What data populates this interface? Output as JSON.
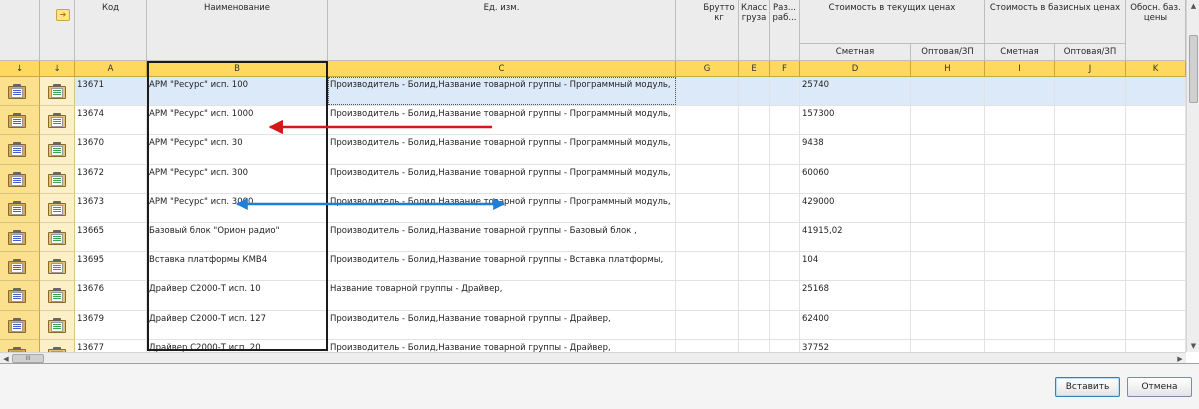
{
  "headers": {
    "col_a": "Код",
    "col_b": "Наименование",
    "col_c": "Ед. изм.",
    "col_g": "Брутто кг",
    "col_e": "Класс груза",
    "col_f": "Раз... раб...",
    "group_current": "Стоимость в текущих ценах",
    "group_base": "Стоимость в базисных ценах",
    "col_k": "Обосн. баз. цены",
    "sub_d": "Сметная",
    "sub_h": "Оптовая/ЗП",
    "sub_i": "Сметная",
    "sub_j": "Оптовая/ЗП"
  },
  "header_icon": "arrow-right-icon",
  "letters": {
    "down1": "↓",
    "down2": "↓",
    "a": "A",
    "b": "B",
    "c": "C",
    "g": "G",
    "e": "E",
    "f": "F",
    "d": "D",
    "h": "H",
    "i": "I",
    "j": "J",
    "k": "K"
  },
  "rows": [
    {
      "code": "13671",
      "name": "АРМ \"Ресурс\" исп. 100",
      "unit": "Производитель - Болид,Название товарной группы - Программный модуль,",
      "price": "25740",
      "selected": true
    },
    {
      "code": "13674",
      "name": "АРМ \"Ресурс\" исп. 1000",
      "unit": "Производитель - Болид,Название товарной группы - Программный модуль,",
      "price": "157300"
    },
    {
      "code": "13670",
      "name": "АРМ \"Ресурс\" исп. 30",
      "unit": "Производитель - Болид,Название товарной группы - Программный модуль,",
      "price": "9438"
    },
    {
      "code": "13672",
      "name": "АРМ \"Ресурс\" исп. 300",
      "unit": "Производитель - Болид,Название товарной группы - Программный модуль,",
      "price": "60060"
    },
    {
      "code": "13673",
      "name": "АРМ \"Ресурс\" исп. 3000",
      "unit": "Производитель - Болид,Название товарной группы - Программный модуль,",
      "price": "429000"
    },
    {
      "code": "13665",
      "name": "Базовый блок \"Орион радио\"",
      "unit": "Производитель - Болид,Название товарной группы - Базовый блок ,",
      "price": "41915,02"
    },
    {
      "code": "13695",
      "name": "Вставка платформы КМВ4",
      "unit": "Производитель - Болид,Название товарной группы - Вставка платформы,",
      "price": "104"
    },
    {
      "code": "13676",
      "name": "Драйвер С2000-Т исп. 10",
      "unit": "Название товарной группы - Драйвер,",
      "price": "25168"
    },
    {
      "code": "13679",
      "name": "Драйвер С2000-Т исп. 127",
      "unit": "Производитель - Болид,Название товарной группы - Драйвер,",
      "price": "62400"
    },
    {
      "code": "13677",
      "name": "Драйвер С2000-Т исп. 20",
      "unit": "Производитель - Болид,Название товарной группы - Драйвер,",
      "price": "37752"
    }
  ],
  "scroll": {
    "up": "▲",
    "down": "▼",
    "left": "◀",
    "right": "▶",
    "grip": "III"
  },
  "buttons": {
    "insert": "Вставить",
    "cancel": "Отмена"
  },
  "annotation_colors": {
    "red_arrow": "#d41818",
    "blue_arrow": "#1f7ed8"
  }
}
